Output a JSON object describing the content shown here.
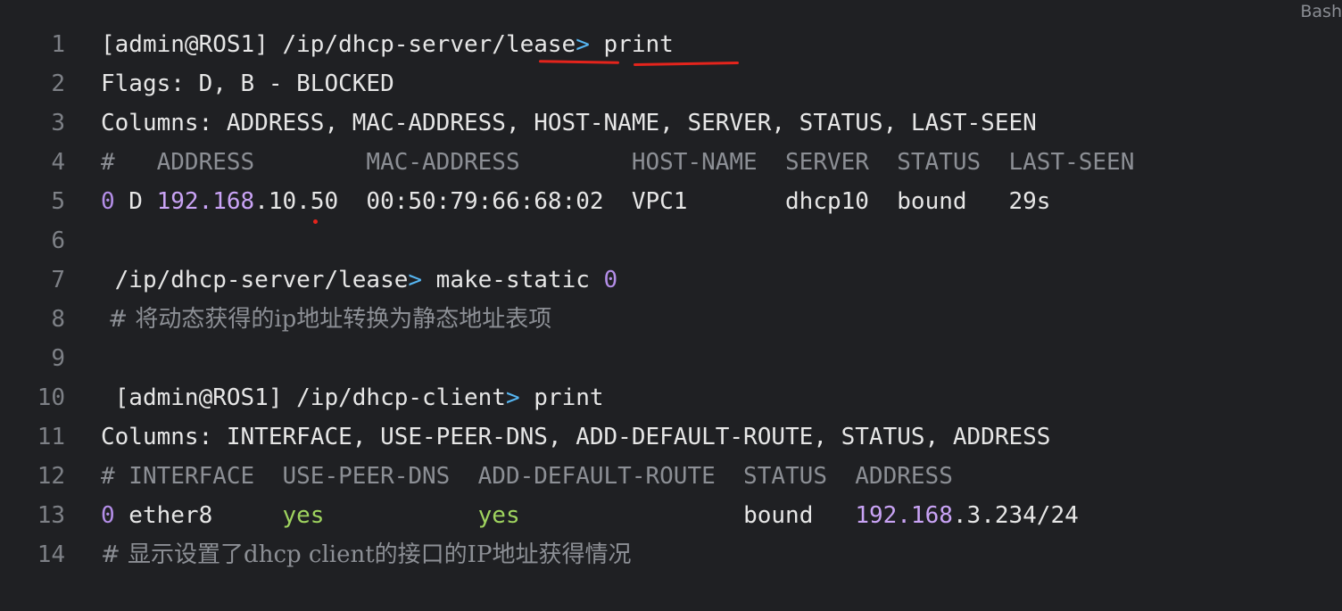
{
  "tab_label": "Bash",
  "lines": [
    {
      "num": "1",
      "tokens": [
        {
          "t": "[admin@ROS1] /ip/dhcp-server/lease",
          "c": "c-default"
        },
        {
          "t": ">",
          "c": "c-op"
        },
        {
          "t": " print",
          "c": "c-default"
        }
      ]
    },
    {
      "num": "2",
      "tokens": [
        {
          "t": "Flags: D, B - BLOCKED",
          "c": "c-default"
        }
      ]
    },
    {
      "num": "3",
      "tokens": [
        {
          "t": "Columns: ADDRESS, MAC-ADDRESS, HOST-NAME, SERVER, STATUS, LAST-SEEN",
          "c": "c-default"
        }
      ]
    },
    {
      "num": "4",
      "tokens": [
        {
          "t": "#   ADDRESS        MAC-ADDRESS        HOST-NAME  SERVER  STATUS  LAST-SEEN",
          "c": "c-head"
        }
      ]
    },
    {
      "num": "5",
      "tokens": [
        {
          "t": "0",
          "c": "c-purple"
        },
        {
          "t": " D ",
          "c": "c-default"
        },
        {
          "t": "192.168",
          "c": "c-num"
        },
        {
          "t": ".10.50  00:50:79:66:68:02  VPC1       dhcp10  bound   29s",
          "c": "c-default"
        }
      ]
    },
    {
      "num": "6",
      "tokens": []
    },
    {
      "num": "7",
      "tokens": [
        {
          "t": " /ip/dhcp-server/lease",
          "c": "c-default"
        },
        {
          "t": ">",
          "c": "c-op"
        },
        {
          "t": " make-static ",
          "c": "c-default"
        },
        {
          "t": "0",
          "c": "c-purple"
        }
      ]
    },
    {
      "num": "8",
      "tokens": [
        {
          "t": " # 将动态获得的ip地址转换为静态地址表项",
          "c": "c-comment",
          "cjk": true
        }
      ]
    },
    {
      "num": "9",
      "tokens": []
    },
    {
      "num": "10",
      "tokens": [
        {
          "t": " [admin@ROS1] /ip/dhcp-client",
          "c": "c-default"
        },
        {
          "t": ">",
          "c": "c-op"
        },
        {
          "t": " print",
          "c": "c-default"
        }
      ]
    },
    {
      "num": "11",
      "tokens": [
        {
          "t": "Columns: INTERFACE, USE-PEER-DNS, ADD-DEFAULT-ROUTE, STATUS, ADDRESS",
          "c": "c-default"
        }
      ]
    },
    {
      "num": "12",
      "tokens": [
        {
          "t": "# INTERFACE  USE-PEER-DNS  ADD-DEFAULT-ROUTE  STATUS  ADDRESS",
          "c": "c-head"
        }
      ]
    },
    {
      "num": "13",
      "tokens": [
        {
          "t": "0",
          "c": "c-purple"
        },
        {
          "t": " ether8     ",
          "c": "c-default"
        },
        {
          "t": "yes",
          "c": "c-green"
        },
        {
          "t": "           ",
          "c": "c-default"
        },
        {
          "t": "yes",
          "c": "c-green"
        },
        {
          "t": "                bound   ",
          "c": "c-default"
        },
        {
          "t": "192.168",
          "c": "c-num"
        },
        {
          "t": ".3.234/24",
          "c": "c-default"
        }
      ]
    },
    {
      "num": "14",
      "tokens": [
        {
          "t": "# 显示设置了dhcp client的接口的IP地址获得情况",
          "c": "c-comment",
          "cjk": true
        }
      ]
    }
  ]
}
